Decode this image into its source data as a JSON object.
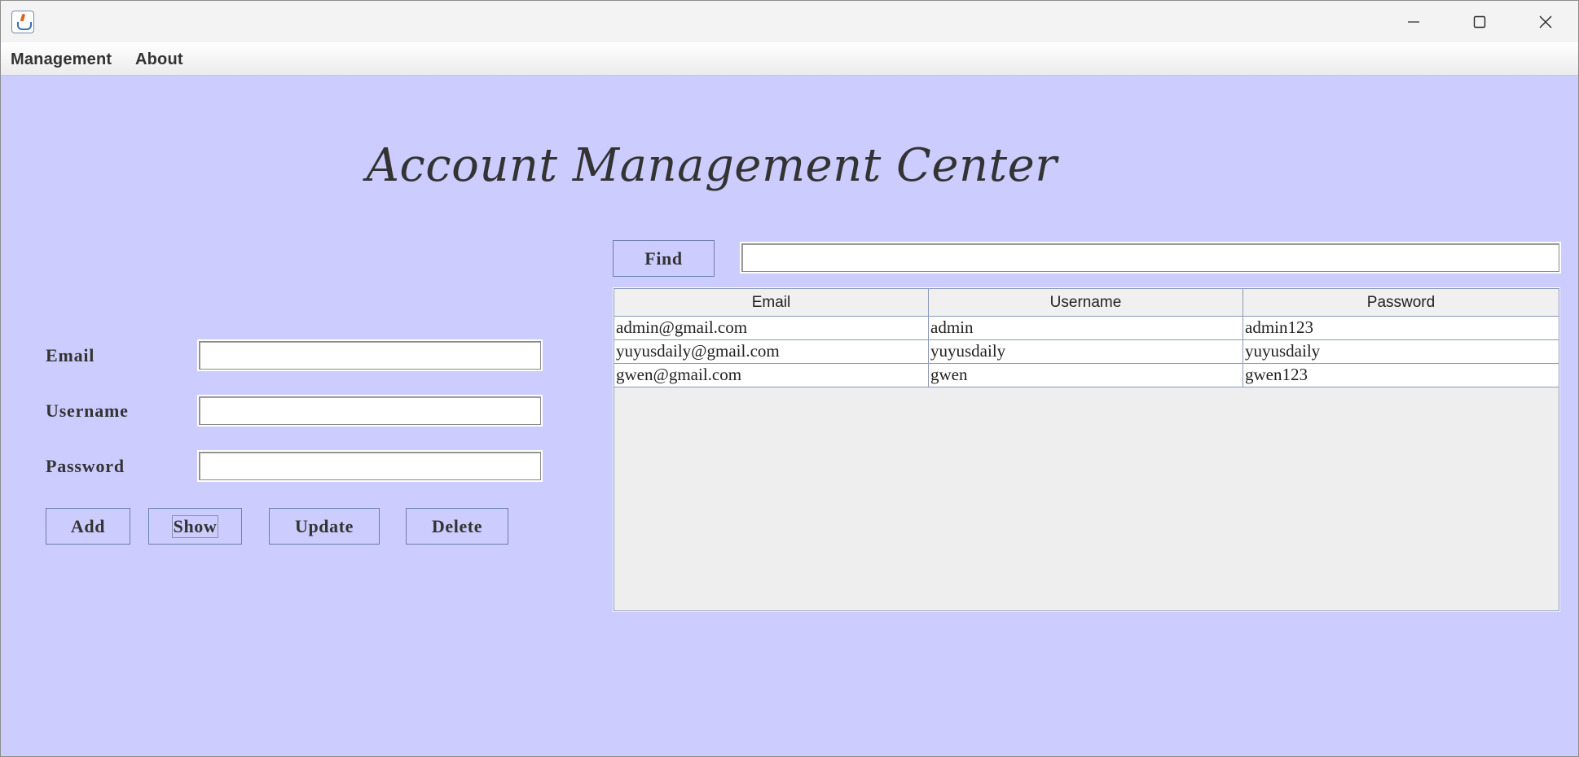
{
  "menubar": {
    "items": [
      "Management",
      "About"
    ]
  },
  "heading": {
    "title": "Account Management Center"
  },
  "form": {
    "email_label": "Email",
    "username_label": "Username",
    "password_label": "Password",
    "email_value": "",
    "username_value": "",
    "password_value": ""
  },
  "buttons": {
    "add": "Add",
    "show": "Show",
    "update": "Update",
    "delete": "Delete",
    "find": "Find"
  },
  "search": {
    "value": ""
  },
  "table": {
    "columns": [
      "Email",
      "Username",
      "Password"
    ],
    "rows": [
      [
        "admin@gmail.com",
        "admin",
        "admin123"
      ],
      [
        "yuyusdaily@gmail.com",
        "yuyusdaily",
        "yuyusdaily"
      ],
      [
        "gwen@gmail.com",
        "gwen",
        "gwen123"
      ]
    ]
  },
  "icons": {
    "app": "java-coffee-cup-icon",
    "minimize": "minimize-icon",
    "maximize": "maximize-icon",
    "close": "close-icon"
  },
  "colors": {
    "background": "#ccccff",
    "text": "#333333"
  }
}
